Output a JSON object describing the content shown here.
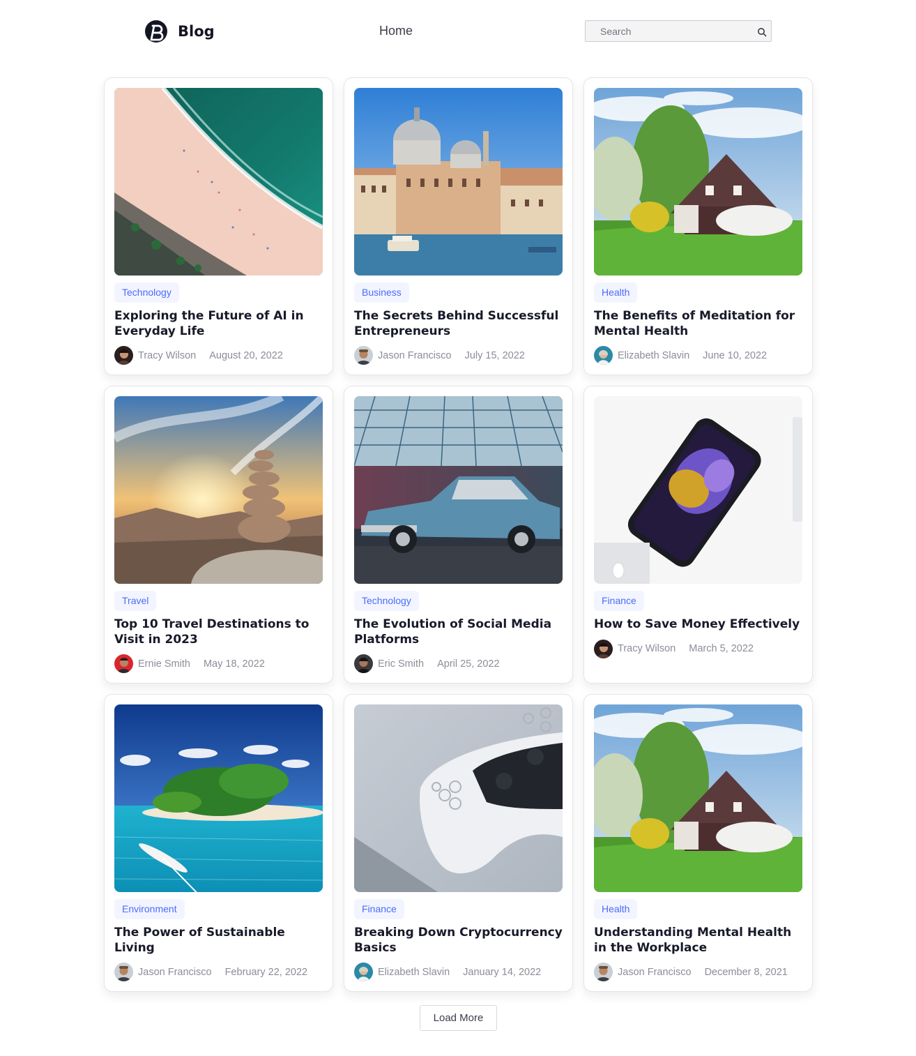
{
  "header": {
    "logo_text": "Blog",
    "nav_home": "Home",
    "search_placeholder": "Search"
  },
  "posts": [
    {
      "category": "Technology",
      "title": "Exploring the Future of AI in Everyday Life",
      "author": "Tracy Wilson",
      "date": "August 20, 2022",
      "image": "beach-aerial"
    },
    {
      "category": "Business",
      "title": "The Secrets Behind Successful Entrepreneurs",
      "author": "Jason Francisco",
      "date": "July 15, 2022",
      "image": "venice-domes"
    },
    {
      "category": "Health",
      "title": "The Benefits of Meditation for Mental Health",
      "author": "Elizabeth Slavin",
      "date": "June 10, 2022",
      "image": "countryside-house"
    },
    {
      "category": "Travel",
      "title": "Top 10 Travel Destinations to Visit in 2023",
      "author": "Ernie Smith",
      "date": "May 18, 2022",
      "image": "stacked-rocks-sunset"
    },
    {
      "category": "Technology",
      "title": "The Evolution of Social Media Platforms",
      "author": "Eric Smith",
      "date": "April 25, 2022",
      "image": "vintage-car"
    },
    {
      "category": "Finance",
      "title": "How to Save Money Effectively",
      "author": "Tracy Wilson",
      "date": "March 5, 2022",
      "image": "smartphone-desk"
    },
    {
      "category": "Environment",
      "title": "The Power of Sustainable Living",
      "author": "Jason Francisco",
      "date": "February 22, 2022",
      "image": "tropical-island"
    },
    {
      "category": "Finance",
      "title": "Breaking Down Cryptocurrency Basics",
      "author": "Elizabeth Slavin",
      "date": "January 14, 2022",
      "image": "game-controller"
    },
    {
      "category": "Health",
      "title": "Understanding Mental Health in the Workplace",
      "author": "Jason Francisco",
      "date": "December 8, 2021",
      "image": "countryside-house"
    }
  ],
  "load_more_label": "Load More",
  "colors": {
    "accent": "#4b6bfb",
    "tag_bg": "#f2f4ff",
    "meta_text": "#8c8d97",
    "title_text": "#181a2a"
  }
}
